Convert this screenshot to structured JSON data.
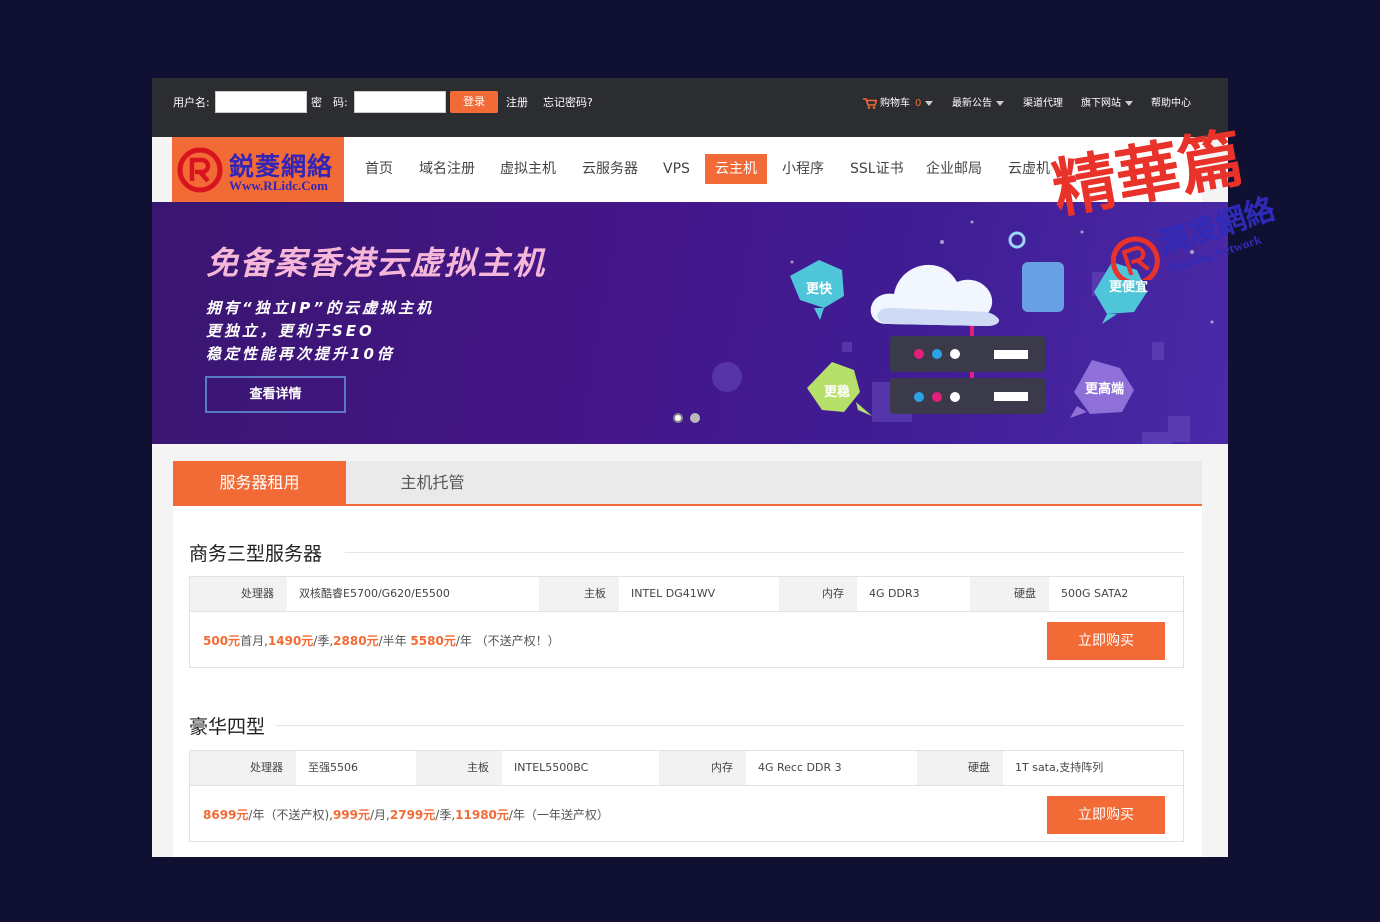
{
  "topbar": {
    "username_label": "用户名:",
    "password_label": "密　码:",
    "login_button": "登录",
    "register_link": "注册",
    "forgot_link": "忘记密码?",
    "cart_label": "购物车",
    "cart_count": "0",
    "announcements": "最新公告",
    "channel_agent": "渠道代理",
    "sub_sites": "旗下网站",
    "help_center": "帮助中心"
  },
  "logo": {
    "title": "鋭菱網絡",
    "subtitle": "Www.RLidc.Com"
  },
  "nav": {
    "items": [
      "首页",
      "域名注册",
      "虚拟主机",
      "云服务器",
      "VPS",
      "云主机",
      "小程序",
      "SSL证书",
      "企业邮局",
      "云虚机"
    ],
    "active": "云主机"
  },
  "banner": {
    "title": "免备案香港云虚拟主机",
    "line1": "拥有“独立IP”的云虚拟主机",
    "line2": "更独立，更利于SEO",
    "line3": "稳定性能再次提升10倍",
    "button": "查看详情",
    "bubbles": [
      "更快",
      "更便宜",
      "更稳",
      "更高端"
    ]
  },
  "tabs": {
    "items": [
      "服务器租用",
      "主机托管"
    ]
  },
  "products": [
    {
      "title": "商务三型服务器",
      "cpu_label": "处理器",
      "cpu": "双核酷睿E5700/G620/E5500",
      "board_label": "主板",
      "board": "INTEL DG41WV",
      "ram_label": "内存",
      "ram": "4G DDR3",
      "disk_label": "硬盘",
      "disk": "500G SATA2",
      "prices": [
        "500元",
        "首月,",
        "1490元",
        "/季,",
        "2880元",
        "/半年 ",
        "5580元",
        "/年 （不送产权！）"
      ],
      "buy_button": "立即购买"
    },
    {
      "title": "豪华四型",
      "cpu_label": "处理器",
      "cpu": "至强5506",
      "board_label": "主板",
      "board": "INTEL5500BC",
      "ram_label": "内存",
      "ram": "4G Recc DDR 3",
      "disk_label": "硬盘",
      "disk": "1T sata,支持阵列",
      "prices": [
        "8699元",
        "/年（不送产权),",
        "999元",
        "/月,",
        "2799元",
        "/季,",
        "11980元",
        "/年（一年送产权）"
      ],
      "buy_button": "立即购买"
    }
  ],
  "watermark": {
    "title": "精華篇",
    "brand": "潤凌網絡",
    "brand_en": "Runling Network"
  },
  "colors": {
    "accent": "#f26b36",
    "topbar": "#2c2d31",
    "page_bg": "#101033",
    "banner": "#44168a",
    "logo_text": "#3425b5"
  }
}
